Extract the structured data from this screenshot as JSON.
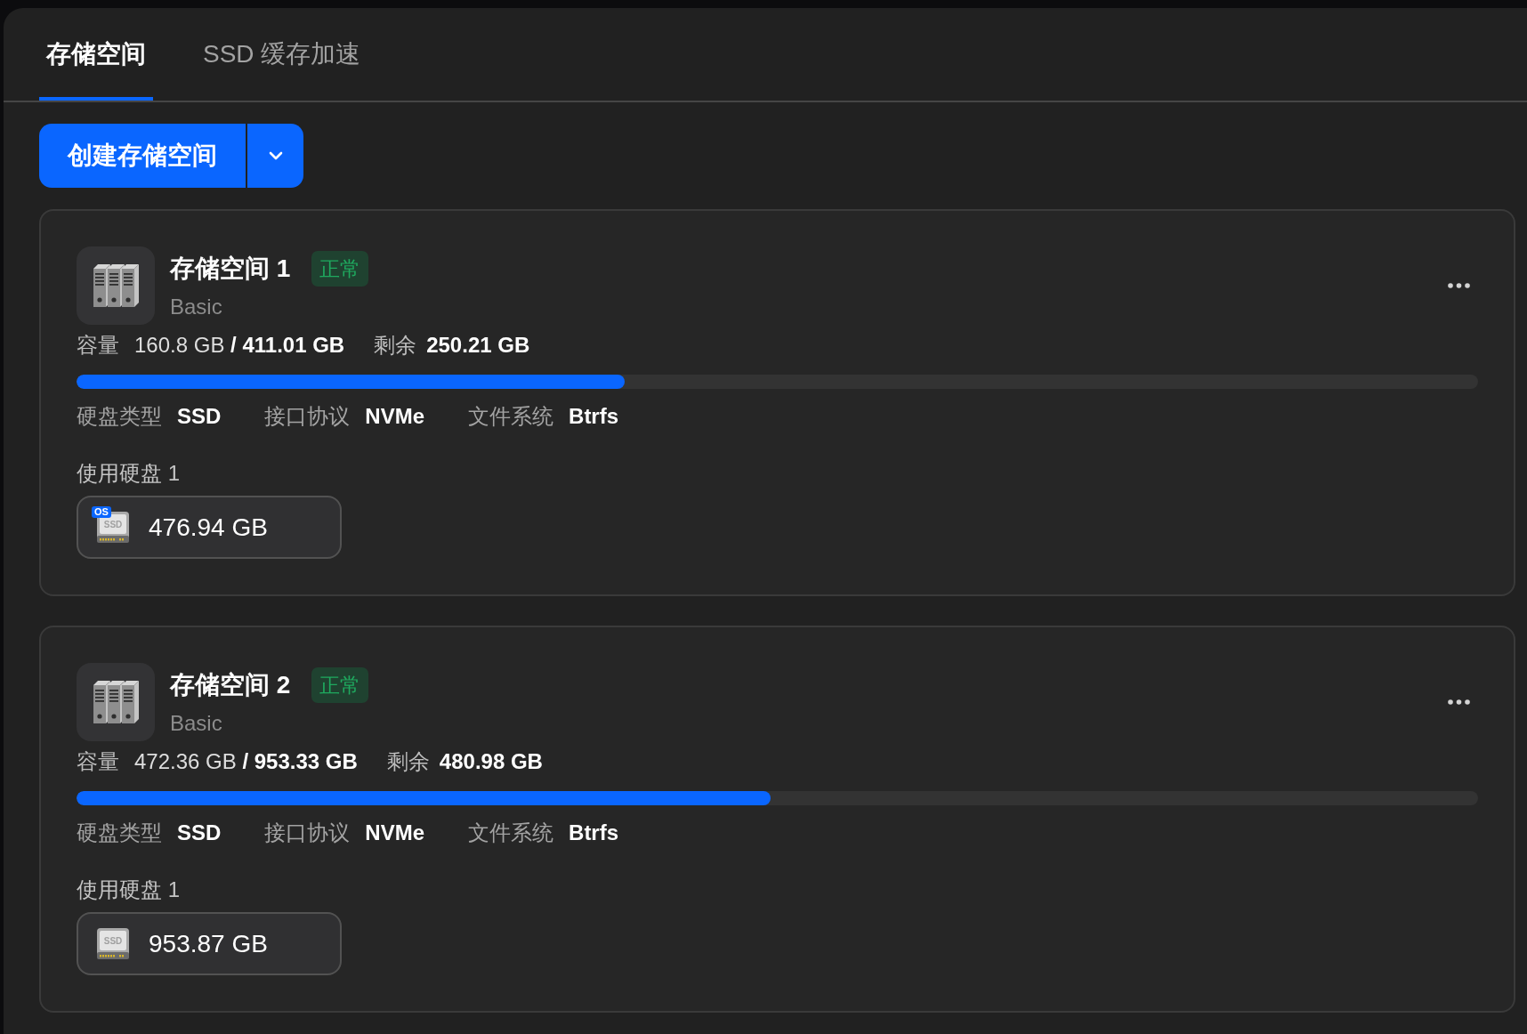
{
  "tabs": [
    {
      "label": "存储空间",
      "selected": true
    },
    {
      "label": "SSD 缓存加速",
      "selected": false
    }
  ],
  "primary_action": {
    "label": "创建存储空间"
  },
  "storage_pools": [
    {
      "name": "存储空间 1",
      "status": "正常",
      "type": "Basic",
      "capacity_label": "容量",
      "capacity_value": "160.8 GB **/ 411.01 GB**",
      "free_label": "剩余",
      "free_value": "250.21 GB",
      "level": 0.391,
      "details": [
        {
          "label": "硬盘类型",
          "value": "SSD"
        },
        {
          "label": "接口协议",
          "value": "NVMe"
        },
        {
          "label": "文件系统",
          "value": "Btrfs"
        }
      ],
      "disks_label": "使用硬盘 1",
      "disks": [
        {
          "size": "476.94 GB",
          "icon_label": "SSD",
          "tag": "OS"
        }
      ]
    },
    {
      "name": "存储空间 2",
      "status": "正常",
      "type": "Basic",
      "capacity_label": "容量",
      "capacity_value": "472.36 GB **/ 953.33 GB**",
      "free_label": "剩余",
      "free_value": "480.98 GB",
      "level": 0.4955,
      "details": [
        {
          "label": "硬盘类型",
          "value": "SSD"
        },
        {
          "label": "接口协议",
          "value": "NVMe"
        },
        {
          "label": "文件系统",
          "value": "Btrfs"
        }
      ],
      "disks_label": "使用硬盘 1",
      "disks": [
        {
          "size": "953.87 GB",
          "icon_label": "SSD"
        }
      ]
    }
  ]
}
